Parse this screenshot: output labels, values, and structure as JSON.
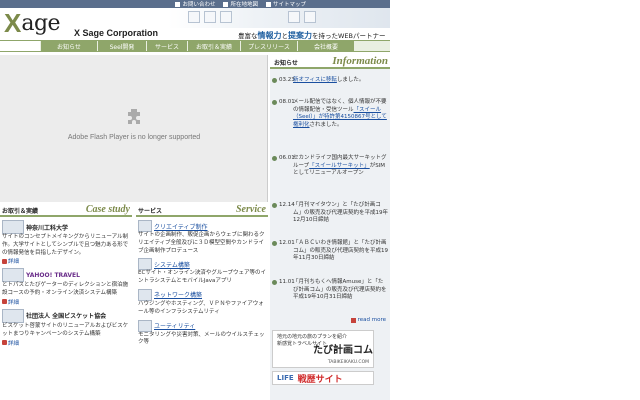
{
  "top_links": [
    {
      "label": "お問い合わせ",
      "icon": "mail-icon"
    },
    {
      "label": "所在地地図",
      "icon": "map-icon"
    },
    {
      "label": "サイトマップ",
      "icon": "sitemap-icon"
    }
  ],
  "brand": {
    "logo_x": "X",
    "logo_rest": "age",
    "corporation": "X Sage Corporation",
    "tagline_pre": "豊富な",
    "tagline_hl1": "情報力",
    "tagline_mid": "と",
    "tagline_hl2": "提案力",
    "tagline_post": "を持ったWEBパートナー"
  },
  "nav": [
    "お知らせ",
    "Seel開発",
    "サービス",
    "お取引＆実績",
    "プレスリリース",
    "会社概要"
  ],
  "flash": {
    "message": "Adobe Flash Player is no longer supported"
  },
  "case_study": {
    "label": "お取引＆実績",
    "title": "Case study",
    "entries": [
      {
        "name": "神奈川工科大学",
        "text": "サイトのコンセプトメイキングからリニューアル制作。大学サイトとしてシンプルで且つ魅力ある形での情報発信を目指したデザイン。",
        "detail": "詳細"
      },
      {
        "name": "YAHOO! TRAVEL",
        "text": "とトパスとたびゲーターのディレクションと宿泊施設コースの予約・オンライン決済システム構築",
        "detail": "詳細"
      },
      {
        "name": "社団法人 全国ビスケット協会",
        "text": "ビスケット啓蒙サイトのリニューアルおよびビスケットまつりキャンペーンのシステム構築",
        "detail": "詳細"
      }
    ]
  },
  "service": {
    "label": "サービス",
    "title": "Service",
    "items": [
      {
        "name": "クリエイティブ制作",
        "text": "サイトの企画制作、販促企画からウェブに関わるクリエイティブ全般及びに３Ｄ模型空間やカンドライブ企画制作プロデュース"
      },
      {
        "name": "システム構築",
        "text": "ECサイト・オンライン決済やグループウェア等のイントラシステムとモバイルJavaアプリ"
      },
      {
        "name": "ネットワーク構築",
        "text": "ハウジングやホスティング、ＶＰＮやファイアウォール等のインフラシステムリティ"
      },
      {
        "name": "ユーティリティ",
        "text": "モニタリングや災害対策、メールのウイルスチェック等"
      }
    ]
  },
  "information": {
    "label": "お知らせ",
    "title": "Information",
    "news": [
      {
        "date": "03.23",
        "link": "新オフィスに移転",
        "text": "しました。"
      },
      {
        "date": "08.01",
        "text_pre": "メール配信ではなく、個人情報が不要の情報配信・受信ツール",
        "link": "「スイール（Seel）」が特許第4150867号として権利化",
        "text": "されました。"
      },
      {
        "date": "06.01",
        "text_pre": "セカンドライフ国内最大サーキットグループ",
        "link": "「スイールサーキット」",
        "text": "がSIMとしてリニューアルオープン"
      },
      {
        "date": "12.14",
        "text": "「月刊マイタウン」と「たび計画コム」の販売及び代理店契約を平成19年12月10日締結"
      },
      {
        "date": "12.01",
        "text": "「ＡＢＣいわき情報館」と「たび計画コム」の販売及び代理店契約を平成19年11月30日締結"
      },
      {
        "date": "11.01",
        "text": "「月刊ちもくへ情報Amuse」と「たび計画コム」の販売及び代理店契約を平成19年10月31日締結"
      }
    ],
    "read_more": "read more",
    "banner1": {
      "text": "地元の地元の旅のプランを紹介\n新感覚トラベルサイト",
      "logo": "たび計画コム",
      "url": "TABIKEIKAKU.COM"
    },
    "banner2": {
      "life": "LIFE",
      "name": "戦歴サイト"
    }
  },
  "colors": {
    "accent": "#8fa66a",
    "topbar": "#5a6e8c",
    "link": "#1a4fa0",
    "info_bg": "#eef1f4"
  }
}
